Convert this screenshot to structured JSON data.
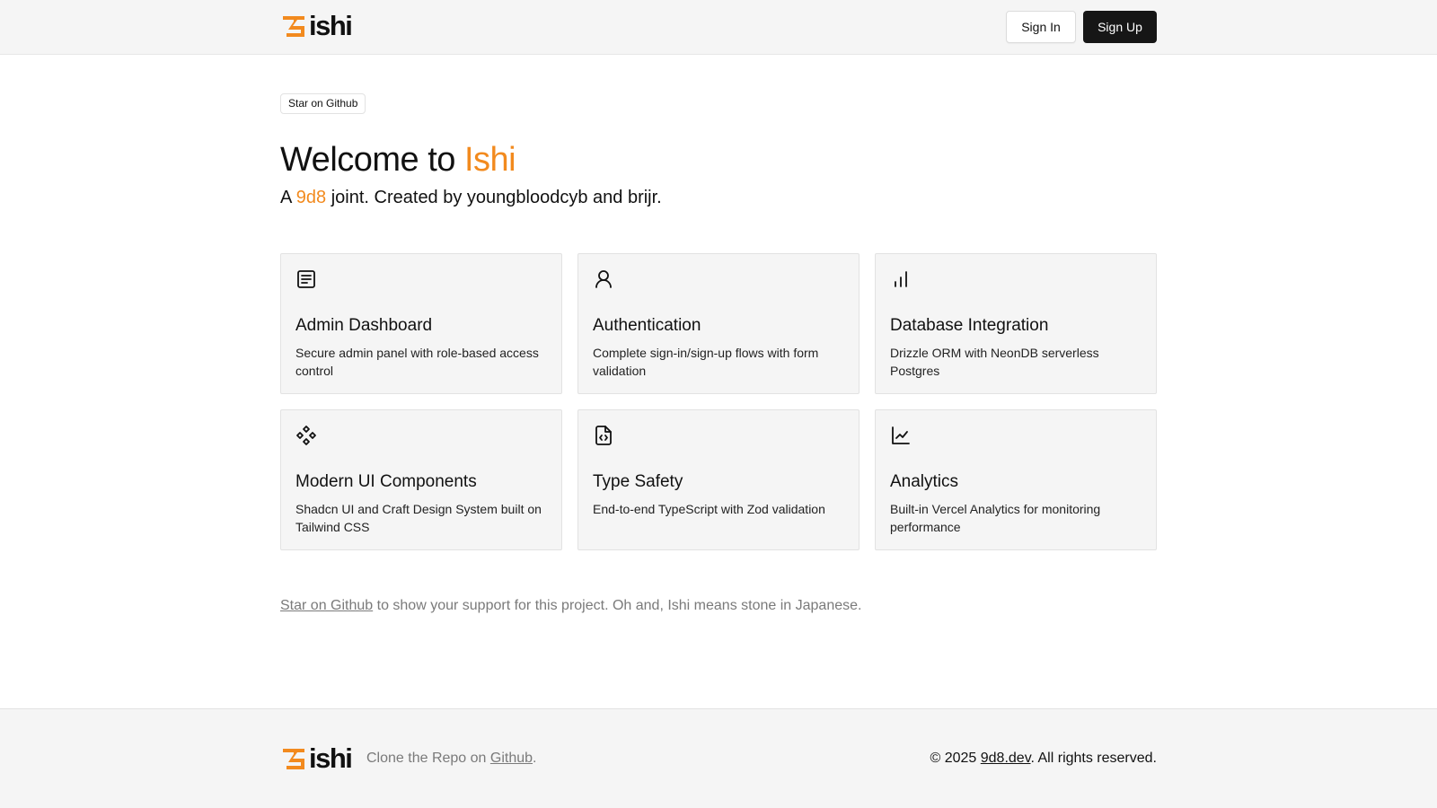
{
  "brand": {
    "logo_text": "ishi",
    "logo_icon": "ishi-logo-icon",
    "accent_color": "#f28a1e"
  },
  "header": {
    "sign_in": "Sign In",
    "sign_up": "Sign Up"
  },
  "hero": {
    "badge": "Star on Github",
    "title_prefix": "Welcome to ",
    "title_accent": "Ishi",
    "sub_prefix": "A ",
    "sub_accent": "9d8",
    "sub_suffix": " joint. Created by youngbloodcyb and brijr."
  },
  "features": [
    {
      "icon": "document-icon",
      "title": "Admin Dashboard",
      "description": "Secure admin panel with role-based access control"
    },
    {
      "icon": "user-icon",
      "title": "Authentication",
      "description": "Complete sign-in/sign-up flows with form validation"
    },
    {
      "icon": "bar-chart-icon",
      "title": "Database Integration",
      "description": "Drizzle ORM with NeonDB serverless Postgres"
    },
    {
      "icon": "components-icon",
      "title": "Modern UI Components",
      "description": "Shadcn UI and Craft Design System built on Tailwind CSS"
    },
    {
      "icon": "file-code-icon",
      "title": "Type Safety",
      "description": "End-to-end TypeScript with Zod validation"
    },
    {
      "icon": "line-chart-icon",
      "title": "Analytics",
      "description": "Built-in Vercel Analytics for monitoring performance"
    }
  ],
  "support": {
    "link": "Star on Github",
    "text": " to show your support for this project. Oh and, Ishi means stone in Japanese."
  },
  "footer": {
    "clone_prefix": "Clone the Repo on ",
    "clone_link": "Github",
    "clone_suffix": ".",
    "copy_prefix": "© 2025 ",
    "copy_link": "9d8.dev",
    "copy_suffix": ". All rights reserved."
  }
}
